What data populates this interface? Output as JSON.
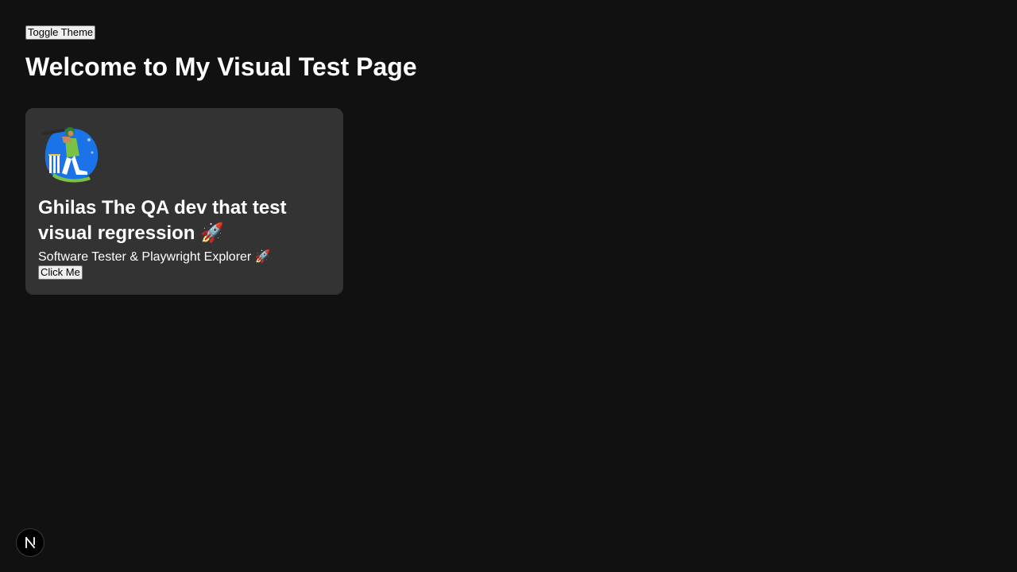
{
  "header": {
    "toggle_theme_label": "Toggle Theme",
    "title": "Welcome to My Visual Test Page"
  },
  "card": {
    "avatar_icon": "cricket-batsman-avatar",
    "title": "Ghilas The QA dev that test visual regression 🚀",
    "subtitle": "Software Tester & Playwright Explorer 🚀",
    "button_label": "Click Me"
  },
  "dev_badge": {
    "icon": "nextjs-logo-icon"
  },
  "colors": {
    "background": "#111111",
    "card_background": "#333333",
    "text": "#ffffff"
  }
}
